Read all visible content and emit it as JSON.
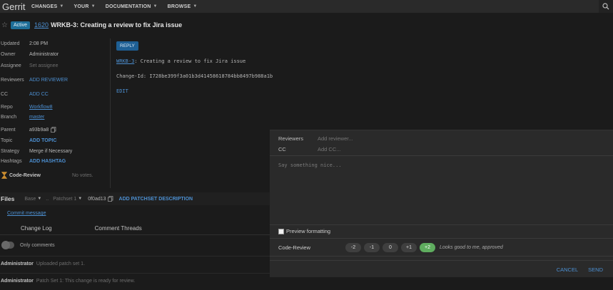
{
  "topbar": {
    "logo": "Gerrit",
    "nav": [
      "CHANGES",
      "YOUR",
      "DOCUMENTATION",
      "BROWSE"
    ]
  },
  "change": {
    "status": "Active",
    "number": "1620",
    "title": "WRKB-3: Creating a review to fix Jira issue"
  },
  "meta": {
    "updated_label": "Updated",
    "updated_value": "2:08 PM",
    "owner_label": "Owner",
    "owner_value": "Administrator",
    "assignee_label": "Assignee",
    "assignee_value": "Set assignee",
    "reviewers_label": "Reviewers",
    "reviewers_value": "ADD REVIEWER",
    "cc_label": "CC",
    "cc_value": "ADD CC",
    "repo_label": "Repo",
    "repo_value": "Workflow8",
    "branch_label": "Branch",
    "branch_value": "master",
    "parent_label": "Parent",
    "parent_value": "a93b9a8",
    "topic_label": "Topic",
    "topic_value": "ADD TOPIC",
    "strategy_label": "Strategy",
    "strategy_value": "Merge if Necessary",
    "hashtags_label": "Hashtags",
    "hashtags_value": "ADD HASHTAG"
  },
  "code_review": {
    "label": "Code-Review",
    "value": "No votes."
  },
  "commit": {
    "reply_label": "REPLY",
    "msg_link": "WRKB-3",
    "msg_rest": ": Creating a review to fix Jira issue",
    "change_id": "Change-Id: I728be399f3a01b3d41458618784bb8497b988a1b",
    "edit_label": "EDIT"
  },
  "files_bar": {
    "title": "Files",
    "base": "Base",
    "arrow": "..",
    "patchset": "Patchset 1",
    "commit": "0f0ad13",
    "add_desc": "ADD PATCHSET DESCRIPTION"
  },
  "commit_message_link": "Commit message",
  "tabs": {
    "change_log": "Change Log",
    "threads": "Comment Threads"
  },
  "only_comments": "Only comments",
  "messages": [
    {
      "author": "Administrator",
      "text": "Uploaded patch set 1."
    },
    {
      "author": "Administrator",
      "text": "Patch Set 1: This change is ready for review."
    }
  ],
  "dialog": {
    "reviewers_label": "Reviewers",
    "reviewers_placeholder": "Add reviewer...",
    "cc_label": "CC",
    "cc_placeholder": "Add CC...",
    "comment_placeholder": "Say something nice...",
    "preview_label": "Preview formatting",
    "code_review_label": "Code-Review",
    "votes": [
      "-2",
      "-1",
      "0",
      "+1",
      "+2"
    ],
    "selected_vote": "+2",
    "vote_desc": "Looks good to me, approved",
    "cancel": "CANCEL",
    "send": "SEND"
  },
  "colors": {
    "accent": "#4c8fd1",
    "approve": "#5fad5f",
    "status": "#1e6e98"
  }
}
